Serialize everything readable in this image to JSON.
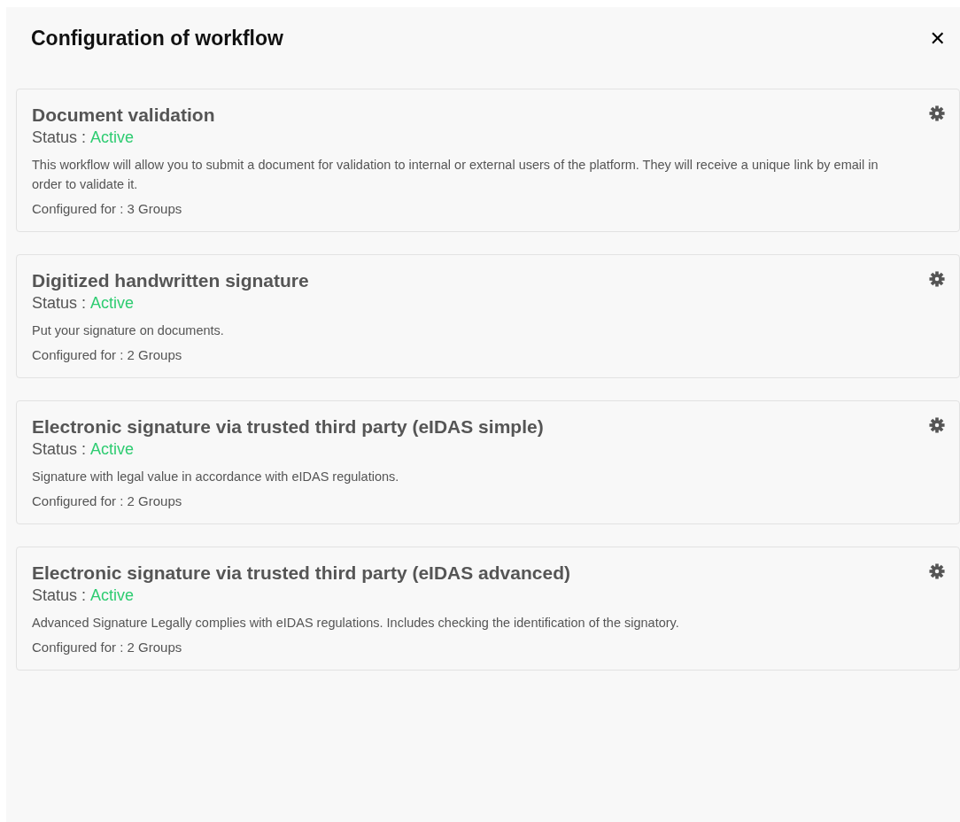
{
  "dialog": {
    "title": "Configuration of workflow",
    "close": "✕"
  },
  "workflows": [
    {
      "title": "Document validation",
      "status_label": "Status :",
      "status": "Active",
      "active": true,
      "description": "This workflow will allow you to submit a document for validation to internal or external users of the platform. They will receive a unique link by email in order to validate it.",
      "configured": "Configured for : 3 Groups"
    },
    {
      "title": "Digitized handwritten signature",
      "status_label": "Status :",
      "status": "Active",
      "active": true,
      "description": "Put your signature on documents.",
      "configured": "Configured for : 2 Groups"
    },
    {
      "title": "Electronic signature via trusted third party (eIDAS simple)",
      "status_label": "Status :",
      "status": "Active",
      "active": true,
      "description": "Signature with legal value in accordance with eIDAS regulations.",
      "configured": "Configured for : 2 Groups"
    },
    {
      "title": "Electronic signature via trusted third party (eIDAS advanced)",
      "status_label": "Status :",
      "status": "Active",
      "active": true,
      "description": "Advanced Signature Legally complies with eIDAS regulations. Includes checking the identification of the signatory.",
      "configured": "Configured for : 2 Groups"
    }
  ]
}
